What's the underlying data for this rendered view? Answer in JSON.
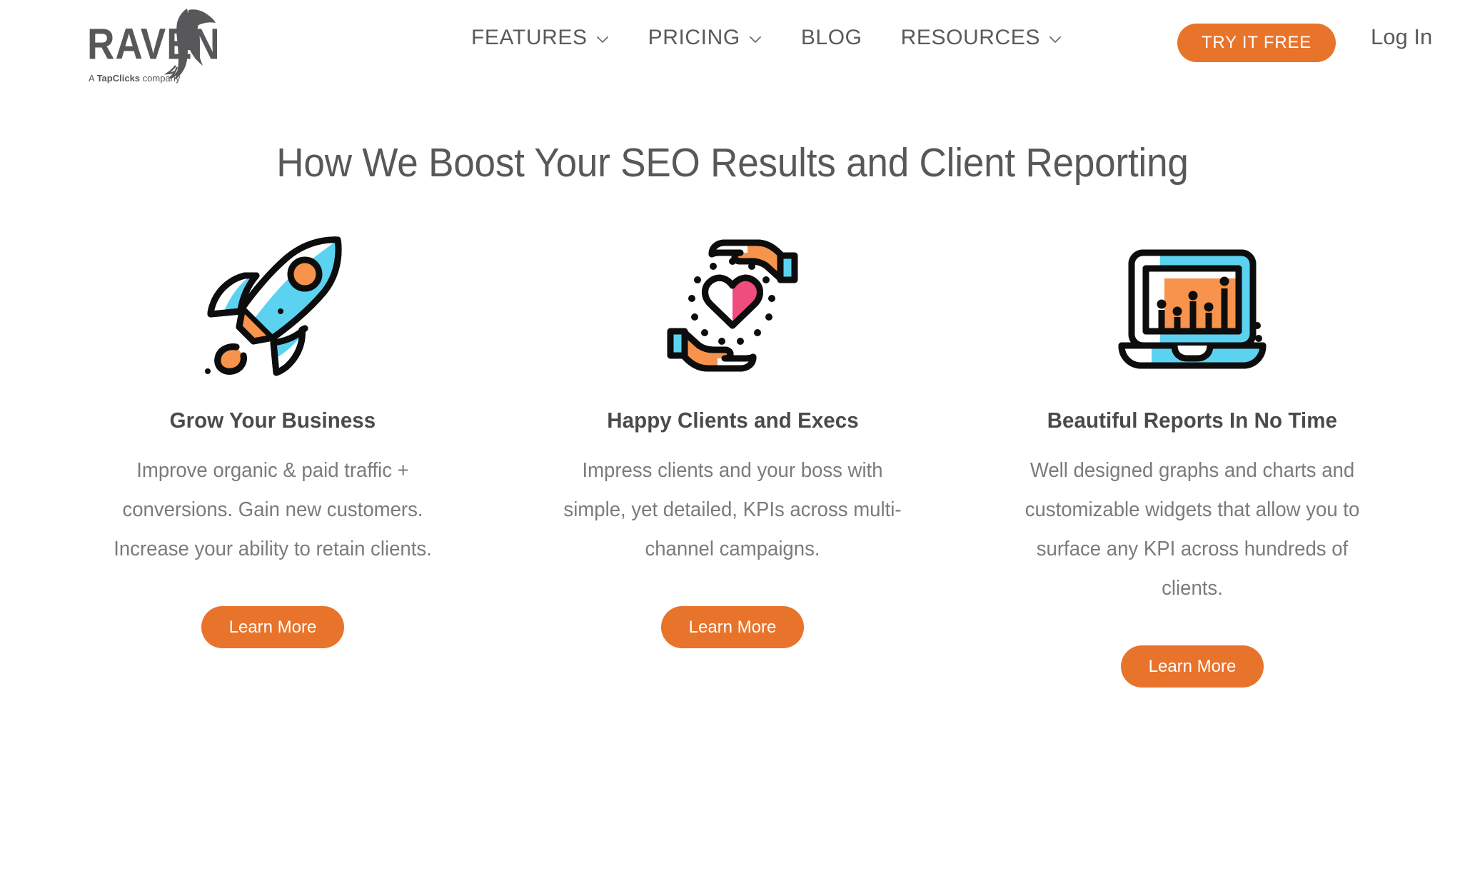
{
  "brand": {
    "name": "RAVEN",
    "tagline": "A TapClicks company",
    "logo_icon": "raven-bird-logo",
    "accent_color": "#E8732A",
    "text_color": "#5a5a5a"
  },
  "header": {
    "nav": [
      {
        "label": "FEATURES",
        "has_dropdown": true,
        "icon": "chevron-down-icon"
      },
      {
        "label": "PRICING",
        "has_dropdown": true,
        "icon": "chevron-down-icon"
      },
      {
        "label": "BLOG",
        "has_dropdown": false,
        "icon": ""
      },
      {
        "label": "RESOURCES",
        "has_dropdown": true,
        "icon": "chevron-down-icon"
      }
    ],
    "cta_label": "TRY IT FREE",
    "login_label": "Log In"
  },
  "main": {
    "title": "How We Boost Your SEO Results and Client Reporting",
    "cards": [
      {
        "icon": "rocket-icon",
        "title": "Grow Your Business",
        "body": "Improve organic & paid traffic + conversions. Gain new customers. Increase your ability to retain clients.",
        "button_label": "Learn More"
      },
      {
        "icon": "hands-holding-heart-icon",
        "title": "Happy Clients and Execs",
        "body": "Impress clients and your boss with simple, yet detailed, KPIs across multi-channel campaigns.",
        "button_label": "Learn More"
      },
      {
        "icon": "laptop-chart-icon",
        "title": "Beautiful Reports In No Time",
        "body": "Well designed graphs and charts and customizable widgets that allow you to surface any KPI across hundreds of clients.",
        "button_label": "Learn More"
      }
    ]
  }
}
